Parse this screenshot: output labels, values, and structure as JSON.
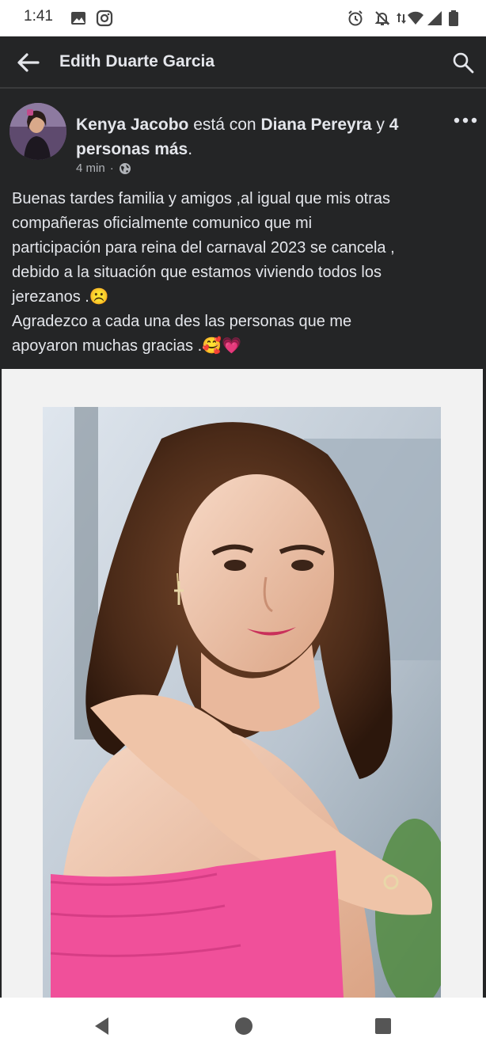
{
  "status_bar": {
    "time": "1:41",
    "left_icons": [
      "image-icon",
      "instagram-icon"
    ],
    "right_icons": [
      "alarm-icon",
      "notifications-off-icon",
      "data-arrows-icon",
      "wifi-icon",
      "signal-icon",
      "battery-icon"
    ]
  },
  "app_bar": {
    "title": "Edith Duarte Garcia",
    "back_icon": "arrow-left-icon",
    "search_icon": "search-icon"
  },
  "post": {
    "author": "Kenya Jacobo",
    "with_text": " está con ",
    "tagged": "Diana Pereyra",
    "and_text": " y ",
    "others": "4 personas más",
    "period": ".",
    "time": "4 min",
    "separator": "·",
    "audience_icon": "globe-icon",
    "body_lines": [
      "Buenas tardes familia y amigos ,al igual que mis otras",
      "compañeras oficialmente comunico que mi",
      "participación para reina del carnaval 2023 se cancela ,",
      "debido a la situación que estamos viviendo todos los",
      "jerezanos .☹️",
      "Agradezco a cada una des las personas que me",
      "apoyaron muchas gracias .🥰💗"
    ]
  },
  "nav_bar": {
    "buttons": [
      "back-triangle-icon",
      "home-circle-icon",
      "recents-square-icon"
    ]
  },
  "colors": {
    "background": "#242526",
    "text": "#e4e6eb",
    "secondary_text": "#b0b3b8",
    "status_bar": "#ffffff",
    "dress_pink": "#f0509a"
  }
}
